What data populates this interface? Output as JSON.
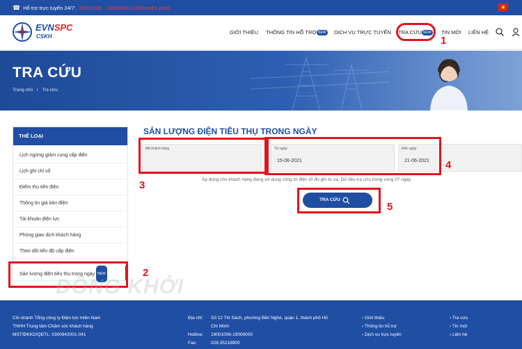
{
  "topbar": {
    "hotline_label": "Hỗ trợ trực tuyến 24/7:",
    "hotline_numbers": "19001006 - 19009000 (1000vnđ/1 phút)"
  },
  "header": {
    "brand_main": "EVN",
    "brand_accent": "SPC",
    "brand_sub": "CSKH",
    "nav": {
      "gioi_thieu": "GIỚI THIỆU",
      "thong_tin_ho_tro": "THÔNG TIN HỖ TRỢ",
      "dich_vu": "DỊCH VỤ TRỰC TUYẾN",
      "tra_cuu": "TRA CỨU",
      "tin_moi": "TIN MỚI",
      "lien_he": "LIÊN HỆ",
      "new_badge": "NEW"
    }
  },
  "hero": {
    "title": "TRA CỨU",
    "breadcrumb_home": "Trang chủ",
    "breadcrumb_sep": "/",
    "breadcrumb_current": "Tra cứu"
  },
  "sidebar": {
    "heading": "THỂ LOẠI",
    "items": [
      {
        "label": "Lịch ngừng giảm cung cấp điện"
      },
      {
        "label": "Lịch ghi chỉ số"
      },
      {
        "label": "Điểm thu tiền điện"
      },
      {
        "label": "Thông tin giá bán điện"
      },
      {
        "label": "Tài khoản điện lực"
      },
      {
        "label": "Phòng giao dịch khách hàng"
      },
      {
        "label": "Theo dõi tiến độ cấp điện"
      },
      {
        "label": "Sản lượng điện tiêu thụ trong ngày"
      }
    ]
  },
  "main": {
    "title": "SẢN LƯỢNG ĐIỆN TIÊU THỤ TRONG NGÀY",
    "customer_label": "Mã khách hàng",
    "from_label": "Từ ngày",
    "from_value": "15-06-2021",
    "to_label": "Đến ngày",
    "to_value": "21-06-2021",
    "note": "Áp dụng cho khách hàng đang sử dụng công tơ điện tử đo ghi từ xa. Dữ liệu tra cứu trong vòng 07 ngày",
    "search_button": "TRA CỨU"
  },
  "annotations": {
    "n1": "1",
    "n2": "2",
    "n3": "3",
    "n4": "4",
    "n5": "5"
  },
  "watermark": "ĐỒNG KHỞI",
  "footer": {
    "company_1": "Chi nhánh Tổng công ty Điện lực miền Nam",
    "company_2": "TNHH Trung tâm Chăm sóc khách hàng",
    "company_3": "MST/ĐKKD/QĐTL: 0300942001-041",
    "address_label": "Địa chỉ:",
    "address_1": "Số 12 Thi Sách, phường Bến Nghé, quận 1, thành phố Hồ",
    "address_2": "Chí Minh",
    "hotline_label": "Hotline:",
    "hotline_value": "19001006-19009000",
    "fax_label": "Fax:",
    "fax_value": "028.35218900",
    "links_1": [
      "Giới thiệu",
      "Thông tin hỗ trợ",
      "Dịch vụ trực tuyến"
    ],
    "links_2": [
      "Tra cứu",
      "Tin mới",
      "Liên hệ"
    ]
  },
  "colors": {
    "primary": "#1f4ea3",
    "accent_red": "#e3131b"
  }
}
